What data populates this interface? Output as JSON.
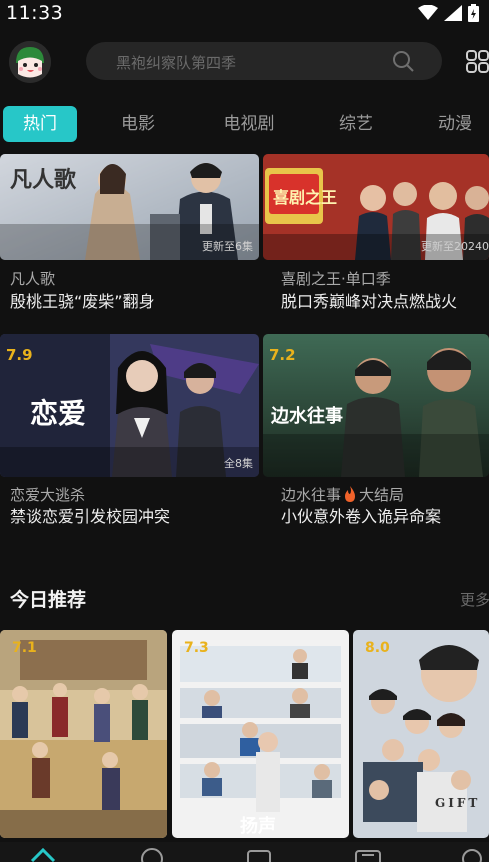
{
  "status": {
    "time": "11:33"
  },
  "search": {
    "placeholder": "黑袍纠察队第四季"
  },
  "tabs": [
    {
      "label": "热门",
      "active": true
    },
    {
      "label": "电影",
      "active": false
    },
    {
      "label": "电视剧",
      "active": false
    },
    {
      "label": "综艺",
      "active": false
    },
    {
      "label": "动漫",
      "active": false
    }
  ],
  "cards": [
    {
      "title": "凡人歌",
      "subtitle": "殷桃王骁“废柴”翻身",
      "badge": "更新至6集",
      "poster_text": "凡人歌"
    },
    {
      "title": "喜剧之王·单口季",
      "subtitle": "脱口秀巅峰对决点燃战火",
      "badge": "更新至20240",
      "poster_text": "喜剧之王"
    },
    {
      "title": "恋爱大逃杀",
      "subtitle": "禁谈恋爱引发校园冲突",
      "badge": "全8集",
      "score": "7.9",
      "poster_text": "恋爱"
    },
    {
      "title": "边水往事",
      "title_suffix": "大结局",
      "subtitle": "小伙意外卷入诡异命案",
      "score": "7.2",
      "poster_text": "边水往事"
    }
  ],
  "section": {
    "title": "今日推荐",
    "more": "更多"
  },
  "recommend": [
    {
      "score": "7.1"
    },
    {
      "score": "7.3",
      "poster_text": "扬声"
    },
    {
      "score": "8.0",
      "poster_text": "GIFT"
    }
  ],
  "colors": {
    "accent": "#27c7c8",
    "score": "#e9b21c",
    "background": "#111111"
  },
  "icons": [
    "wifi-icon",
    "signal-icon",
    "battery-icon",
    "search-icon",
    "grid-icon",
    "home-icon",
    "discover-icon",
    "video-icon",
    "tv-icon",
    "profile-icon"
  ]
}
